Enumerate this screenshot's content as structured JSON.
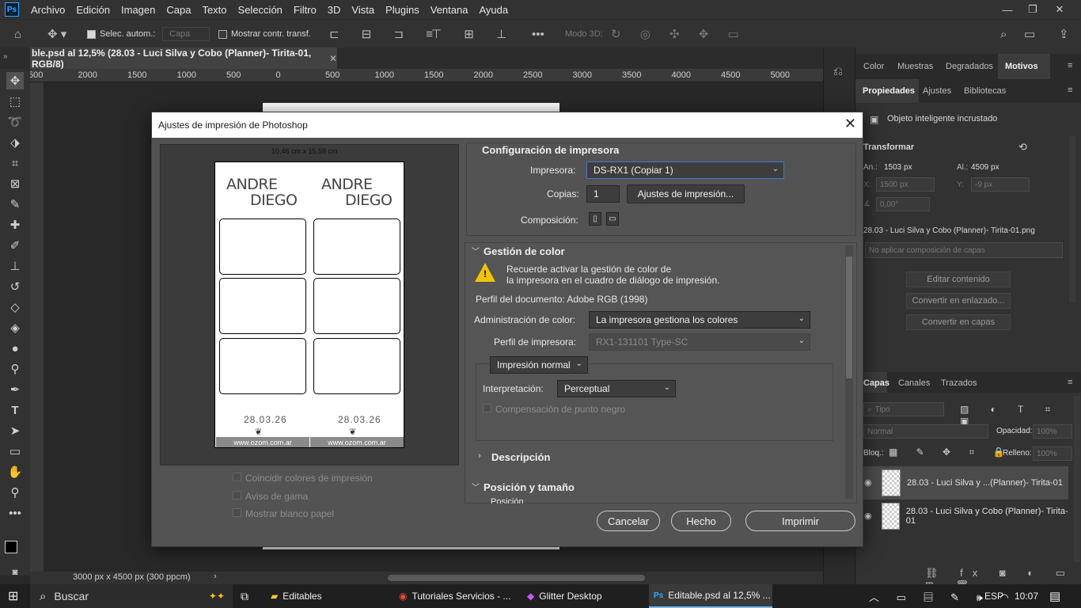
{
  "menu": [
    "Archivo",
    "Edición",
    "Imagen",
    "Capa",
    "Texto",
    "Selección",
    "Filtro",
    "3D",
    "Vista",
    "Plugins",
    "Ventana",
    "Ayuda"
  ],
  "app_badge": "Ps",
  "options": {
    "auto_select_label": "Selec. autom.:",
    "auto_select_target": "Capa",
    "show_transform_label": "Mostrar contr. transf.",
    "mode_3d_label": "Modo 3D:"
  },
  "document_tab": "ble.psd al 12,5% (28.03 - Luci Silva y Cobo (Planner)- Tirita-01, RGB/8)",
  "ruler_ticks": [
    "500",
    "2000",
    "1500",
    "1000",
    "500",
    "0",
    "500",
    "1000",
    "1500",
    "2000",
    "2500",
    "3000",
    "3500",
    "4000",
    "4500",
    "5000"
  ],
  "status_text": "3000 px x 4500 px (300 ppcm)",
  "panels": {
    "top_tabs": [
      "Color",
      "Muestras",
      "Degradados",
      "Motivos"
    ],
    "prop_tabs": [
      "Propiedades",
      "Ajustes",
      "Bibliotecas"
    ],
    "object_type": "Objeto inteligente incrustado",
    "transform_title": "Transformar",
    "w_label": "An.:",
    "w_value": "1503 px",
    "h_label": "Al.:",
    "h_value": "4509 px",
    "x_label": "X:",
    "x_value": "1500 px",
    "y_label": "Y:",
    "y_value": "-9 px",
    "angle_value": "0,00°",
    "file_name": "28.03 - Luci Silva y Cobo (Planner)- Tirita-01.png",
    "layer_comp": "No aplicar composición de capas",
    "edit_content": "Editar contenido",
    "convert_linked": "Convertir en enlazado...",
    "convert_layers": "Convertir en capas",
    "layer_tabs": [
      "Capas",
      "Canales",
      "Trazados"
    ],
    "kind_filter": "Tipo",
    "blend_mode": "Normal",
    "opacity_label": "Opacidad:",
    "opacity_value": "100%",
    "lock_label": "Bloq.:",
    "fill_label": "Relleno:",
    "fill_value": "100%",
    "layers": [
      "28.03 - Luci Silva y ...(Planner)- Tirita-01",
      "28.03 - Luci Silva y Cobo (Planner)- Tirita-01"
    ]
  },
  "dialog": {
    "title": "Ajustes de impresión de Photoshop",
    "paper_size": "10,46 cm x 15,59 cm",
    "brand_line1": "ANDRE",
    "brand_line2": "DIEGO",
    "date": "28.03.26",
    "footer": "www.ozom.com.ar",
    "match_colors": "Coincidir colores de impresión",
    "gamut_warning": "Aviso de gama",
    "show_paper_white": "Mostrar blanco papel",
    "printer_setup_title": "Configuración de impresora",
    "printer_label": "Impresora:",
    "printer_value": "DS-RX1 (Copiar 1)",
    "copies_label": "Copias:",
    "copies_value": "1",
    "print_settings_btn": "Ajustes de impresión...",
    "layout_label": "Composición:",
    "color_mgmt_title": "Gestión de color",
    "warning_line1": "Recuerde activar la gestión de color de",
    "warning_line2": "la impresora en el cuadro de diálogo de impresión.",
    "doc_profile": "Perfil del documento: Adobe RGB (1998)",
    "color_handling_label": "Administración de color:",
    "color_handling_value": "La impresora gestiona los colores",
    "printer_profile_label": "Perfil de impresora:",
    "printer_profile_value": "RX1-131101 Type-SC",
    "normal_print": "Impresión normal",
    "rendering_label": "Interpretación:",
    "rendering_value": "Perceptual",
    "black_point": "Compensación de punto negro",
    "description_title": "Descripción",
    "position_size_title": "Posición y tamaño",
    "position_cut": "Posición",
    "cancel": "Cancelar",
    "done": "Hecho",
    "print": "Imprimir"
  },
  "taskbar": {
    "search": "Buscar",
    "items": [
      "Editables",
      "Tutoriales Servicios - ...",
      "Glitter Desktop",
      "Editable.psd al 12,5% ..."
    ],
    "lang": "ESP",
    "time": "10:07"
  }
}
